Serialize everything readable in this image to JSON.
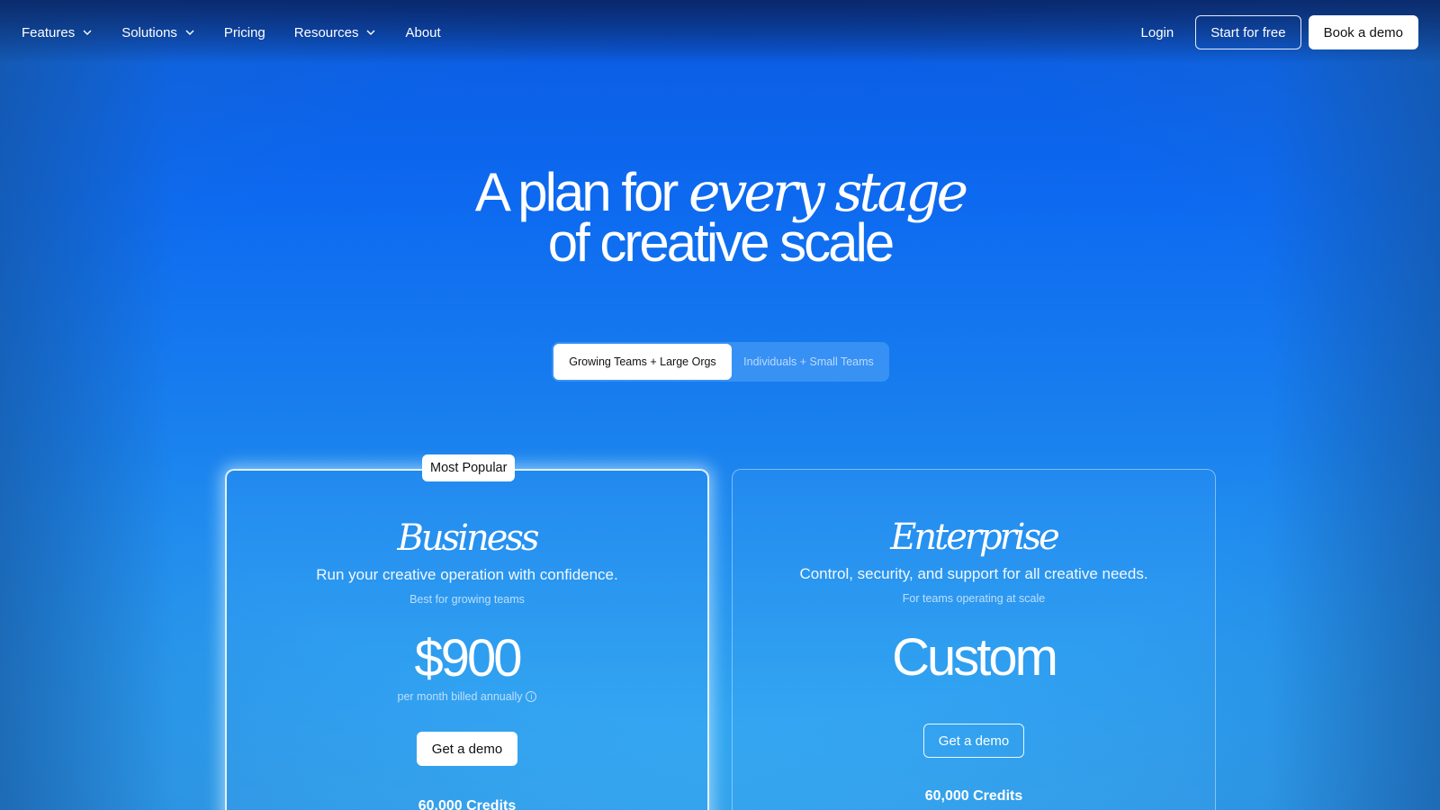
{
  "nav": {
    "items": [
      {
        "label": "Features",
        "has_dropdown": true
      },
      {
        "label": "Solutions",
        "has_dropdown": true
      },
      {
        "label": "Pricing",
        "has_dropdown": false
      },
      {
        "label": "Resources",
        "has_dropdown": true
      },
      {
        "label": "About",
        "has_dropdown": false
      }
    ],
    "login": "Login",
    "start_free": "Start for free",
    "book_demo": "Book a demo"
  },
  "hero": {
    "line1_prefix": "A plan for ",
    "line1_emphasis": "every stage",
    "line2": "of creative scale"
  },
  "audience_toggle": {
    "options": [
      "Growing Teams + Large Orgs",
      "Individuals + Small Teams"
    ],
    "selected": "Growing Teams + Large Orgs"
  },
  "plans": [
    {
      "badge": "Most Popular",
      "name": "Business",
      "tagline": "Run your creative operation with confidence.",
      "subtitle": "Best for growing teams",
      "price": "$900",
      "price_note": "per month billed annually",
      "cta": "Get a demo",
      "credits": "60,000 Credits"
    },
    {
      "name": "Enterprise",
      "tagline": "Control, security, and support for all creative needs.",
      "subtitle": "For teams operating at scale",
      "price": "Custom",
      "cta": "Get a demo",
      "credits": "60,000 Credits"
    }
  ],
  "icons": {
    "dropdown": "chevron-down-icon",
    "info": "info-icon"
  },
  "colors": {
    "background_top": "#0b3f9e",
    "background_mid": "#0d6af0",
    "background_bottom": "#36aef4",
    "button_white": "#ffffff",
    "text_dark": "#111111"
  }
}
